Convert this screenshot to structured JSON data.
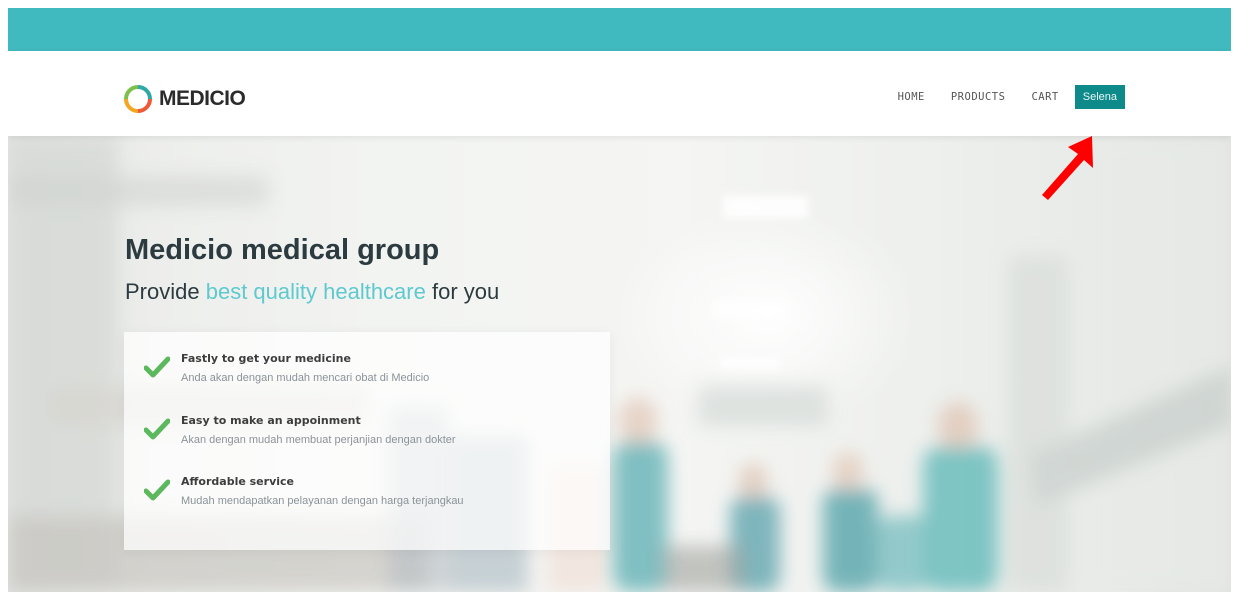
{
  "colors": {
    "top_bar": "#40b9bf",
    "accent": "#5ec9cf",
    "user_button": "#0f8a8a",
    "check": "#5cb85c",
    "annotation_arrow": "#ff0000"
  },
  "header": {
    "logo_text": "MEDICIO",
    "nav": {
      "home": "HOME",
      "products": "PRODUCTS",
      "cart": "CART",
      "user": "Selena"
    }
  },
  "hero": {
    "title": "Medicio medical group",
    "subtitle_pre": "Provide ",
    "subtitle_highlight": "best quality healthcare",
    "subtitle_post": " for you",
    "features": [
      {
        "title": "Fastly to get your medicine",
        "desc": "Anda akan dengan mudah mencari obat di Medicio",
        "icon": "check-icon"
      },
      {
        "title": "Easy to make an appoinment",
        "desc": "Akan dengan mudah membuat perjanjian dengan dokter",
        "icon": "check-icon"
      },
      {
        "title": "Affordable service",
        "desc": "Mudah mendapatkan pelayanan dengan harga terjangkau",
        "icon": "check-icon"
      }
    ]
  }
}
